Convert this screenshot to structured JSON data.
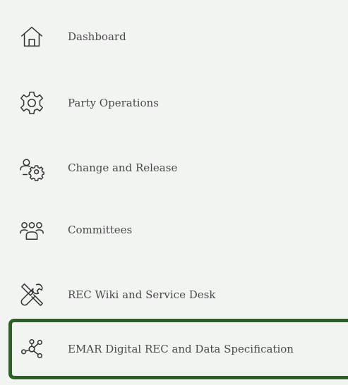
{
  "sidebar": {
    "items": [
      {
        "label": "Dashboard",
        "icon": "home-icon"
      },
      {
        "label": "Party Operations",
        "icon": "gear-icon"
      },
      {
        "label": "Change and Release",
        "icon": "users-gear-icon"
      },
      {
        "label": "Committees",
        "icon": "group-icon"
      },
      {
        "label": "REC Wiki and Service Desk",
        "icon": "tools-icon"
      },
      {
        "label": "EMAR Digital REC and Data Specification",
        "icon": "network-icon",
        "active": true
      }
    ],
    "active_border_color": "#2e5e2a"
  }
}
